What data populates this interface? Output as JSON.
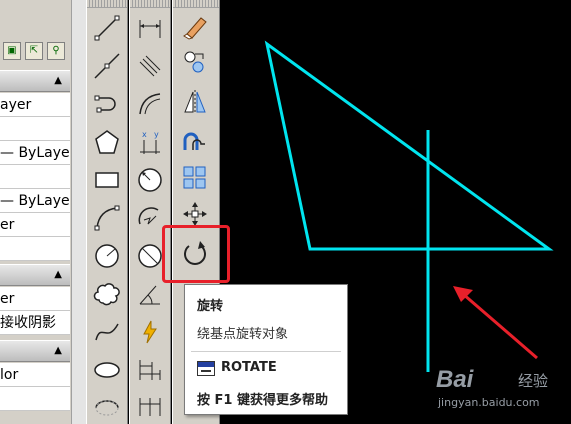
{
  "properties_palette": {
    "rows": [
      {
        "text": "ayer"
      },
      {
        "text": "— ByLayer"
      },
      {
        "text": "— ByLayer"
      },
      {
        "text": "er"
      },
      {
        "text": "er"
      },
      {
        "text": "接收阴影"
      },
      {
        "text": "lor"
      }
    ]
  },
  "tooltip": {
    "title": "旋转",
    "description": "绕基点旋转对象",
    "command": "ROTATE",
    "help": "按 F1 键获得更多帮助"
  },
  "watermark": {
    "brand": "Bai",
    "jingyan": "经验",
    "url": "jingyan.baidu.com"
  },
  "colors": {
    "drawing_lines": "#00e5ef",
    "arrow": "#e8202a",
    "highlight": "#e8202a",
    "toolbar_bg": "#d4d0c8"
  },
  "tools": {
    "draw": [
      "line-icon",
      "construction-line-icon",
      "polyline-icon",
      "polygon-icon",
      "rectangle-icon",
      "arc-icon",
      "circle-icon",
      "revision-cloud-icon",
      "spline-icon",
      "ellipse-icon",
      "ellipse-arc-icon"
    ],
    "dimension": [
      "linear-dimension-icon",
      "aligned-dimension-icon",
      "arc-length-icon",
      "ordinate-dimension-icon",
      "radius-dimension-icon",
      "jogged-dimension-icon",
      "diameter-dimension-icon",
      "angular-dimension-icon",
      "quick-dimension-icon",
      "baseline-dimension-icon",
      "continue-dimension-icon"
    ],
    "modify": [
      "erase-icon",
      "copy-icon",
      "mirror-icon",
      "offset-icon",
      "array-icon",
      "move-icon",
      "rotate-icon"
    ]
  }
}
